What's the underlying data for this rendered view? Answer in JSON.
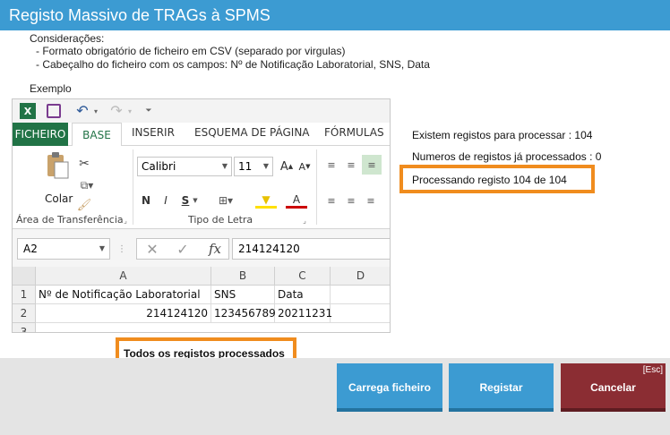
{
  "window": {
    "title": "Registo Massivo de TRAGs à SPMS"
  },
  "considerations": {
    "heading": "Considerações:",
    "items": [
      "-  Formato obrigatório de ficheiro em CSV (separado por virgulas)",
      "-  Cabeçalho do ficheiro com os campos: Nº de Notificação Laboratorial, SNS, Data"
    ],
    "example_label": "Exemplo"
  },
  "excel": {
    "tabs": [
      "FICHEIRO",
      "BASE",
      "INSERIR",
      "ESQUEMA DE PÁGINA",
      "FÓRMULAS"
    ],
    "clipboard": {
      "paste_label": "Colar",
      "group_label": "Área de Transferência"
    },
    "font": {
      "name": "Calibri",
      "size": "11",
      "group_label": "Tipo de Letra",
      "bold": "N",
      "italic": "I",
      "underline": "S"
    },
    "name_box": "A2",
    "formula_value": "214124120",
    "columns": [
      "A",
      "B",
      "C",
      "D"
    ],
    "rows": [
      "1",
      "2",
      "3"
    ],
    "row1": [
      "Nº de Notificação Laboratorial",
      "SNS",
      "Data"
    ],
    "row2": [
      "214124120",
      "123456789",
      "20211231"
    ]
  },
  "status": {
    "pending": "Existem registos para processar : 104",
    "processed": "Numeros de registos já processados : 0",
    "processing": "Processando registo 104 de 104",
    "done": "Todos os registos processados"
  },
  "buttons": {
    "upload": "Carrega ficheiro",
    "register": "Registar",
    "cancel": "Cancelar",
    "cancel_shortcut": "[Esc]"
  },
  "colors": {
    "title_bg": "#3c9bd2",
    "button_blue": "#3c9bd2",
    "button_red": "#8b2d33",
    "highlight": "#f08c1e",
    "excel_green": "#217346"
  }
}
